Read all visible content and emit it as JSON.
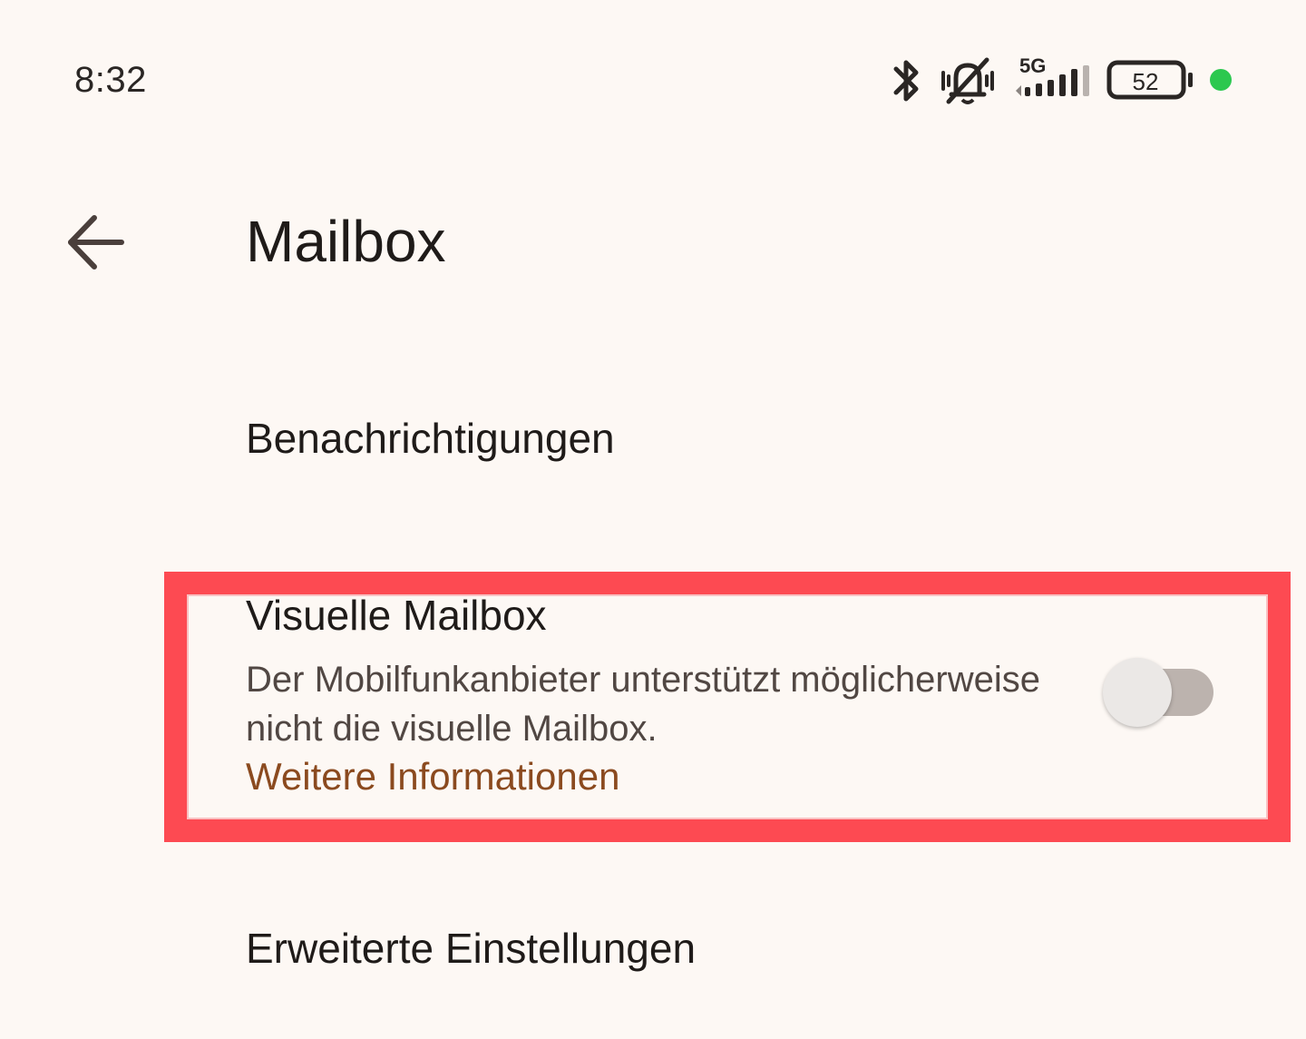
{
  "status_bar": {
    "time": "8:32",
    "network": "5G",
    "battery": "52",
    "icons": [
      "bluetooth-icon",
      "vibrate-mute-icon",
      "signal-icon",
      "battery-icon",
      "privacy-indicator-dot"
    ],
    "dot_color": "#2cc84f"
  },
  "header": {
    "back_icon": "arrow-back-icon",
    "title": "Mailbox"
  },
  "settings": {
    "notifications": "Benachrichtigungen",
    "visual_mailbox": {
      "title": "Visuelle Mailbox",
      "description": "Der Mobilfunkanbieter unterstützt möglicherweise nicht die visuelle Mailbox.",
      "link": "Weitere Informationen",
      "toggle_on": false
    },
    "advanced": "Erweiterte Einstellungen"
  },
  "colors": {
    "background": "#fdf8f4",
    "highlight": "#fd4a52",
    "link": "#8b4a1f"
  }
}
